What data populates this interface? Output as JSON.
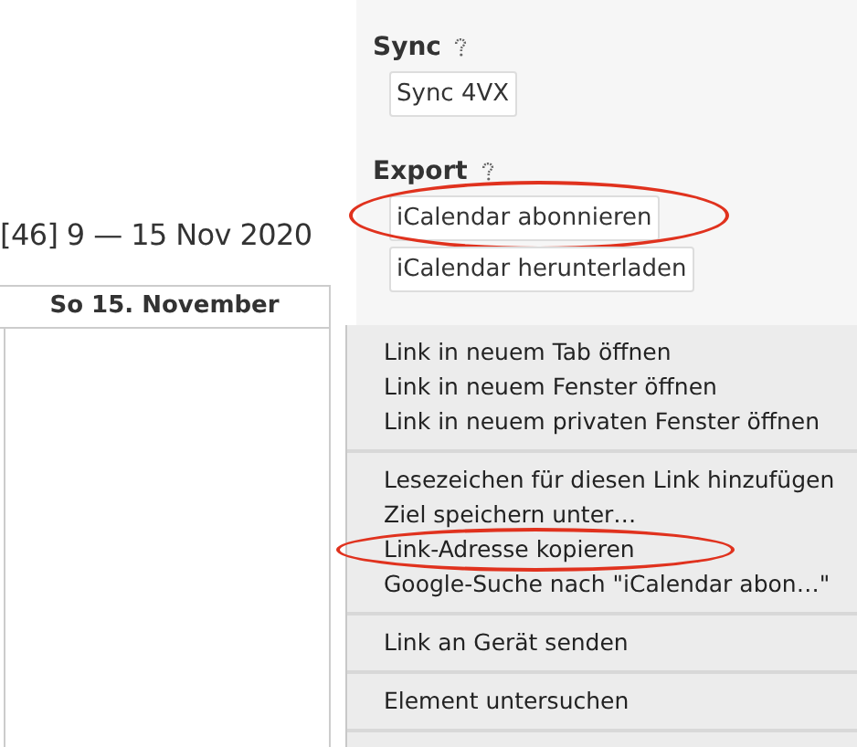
{
  "calendar": {
    "week_title": "[46] 9 — 15 Nov 2020",
    "column_header": "So 15. November"
  },
  "panel": {
    "sections": [
      {
        "heading": "Sync",
        "buttons": [
          {
            "label": "Sync 4VX",
            "circled": false
          }
        ]
      },
      {
        "heading": "Export",
        "buttons": [
          {
            "label": "iCalendar abonnieren",
            "circled": true
          },
          {
            "label": "iCalendar herunterladen",
            "circled": false
          }
        ]
      }
    ]
  },
  "context_menu": {
    "groups": [
      {
        "items": [
          {
            "label": "Link in neuem Tab öffnen",
            "circled": false
          },
          {
            "label": "Link in neuem Fenster öffnen",
            "circled": false
          },
          {
            "label": "Link in neuem privaten Fenster öffnen",
            "circled": false
          }
        ]
      },
      {
        "items": [
          {
            "label": "Lesezeichen für diesen Link hinzufügen",
            "circled": false
          },
          {
            "label": "Ziel speichern unter…",
            "circled": false
          },
          {
            "label": "Link-Adresse kopieren",
            "circled": true
          },
          {
            "label": "Google-Suche nach \"iCalendar abon…\"",
            "circled": false
          }
        ]
      },
      {
        "items": [
          {
            "label": "Link an Gerät senden",
            "circled": false
          }
        ]
      },
      {
        "items": [
          {
            "label": "Element untersuchen",
            "circled": false
          }
        ]
      }
    ]
  }
}
